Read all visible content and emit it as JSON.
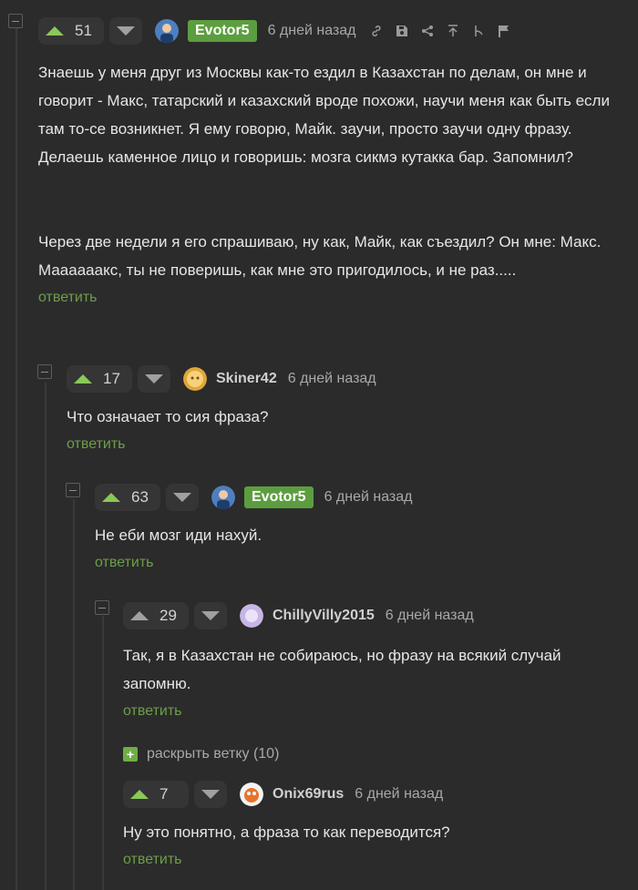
{
  "reply_label": "ответить",
  "comments": [
    {
      "votes": "51",
      "author": "Evotor5",
      "time": "6 дней назад",
      "paragraphs": [
        "Знаешь у меня друг из Москвы как-то ездил в Казахстан по делам, он мне и говорит - Макс, татарский и казахский вроде похожи, научи меня как быть если там то-се возникнет. Я ему говорю, Майк. заучи, просто заучи одну фразу. Делаешь каменное лицо и говоришь: мозга сикмэ кутакка бар. Запомнил?",
        "Через две недели я его спрашиваю, ну как, Майк, как съездил? Он мне: Макс. Маааааакс, ты не поверишь, как мне это пригодилось, и не раз....."
      ]
    },
    {
      "votes": "17",
      "author": "Skiner42",
      "time": "6 дней назад",
      "text": "Что означает то сия фраза?"
    },
    {
      "votes": "63",
      "author": "Evotor5",
      "time": "6 дней назад",
      "text": "Не еби мозг иди нахуй."
    },
    {
      "votes": "29",
      "author": "ChillyVilly2015",
      "time": "6 дней назад",
      "text": "Так, я в Казахстан не собираюсь, но фразу на всякий случай запомню."
    },
    {
      "votes": "7",
      "author": "Onix69rus",
      "time": "6 дней назад",
      "text": "Ну это понятно, а фраза то как переводится?"
    }
  ],
  "expand_branch": {
    "icon": "+",
    "label": "раскрыть ветку (10)"
  },
  "colors": {
    "accent": "#5c9e3f",
    "background": "#2b2b2b",
    "reply": "#6c9e4a"
  }
}
